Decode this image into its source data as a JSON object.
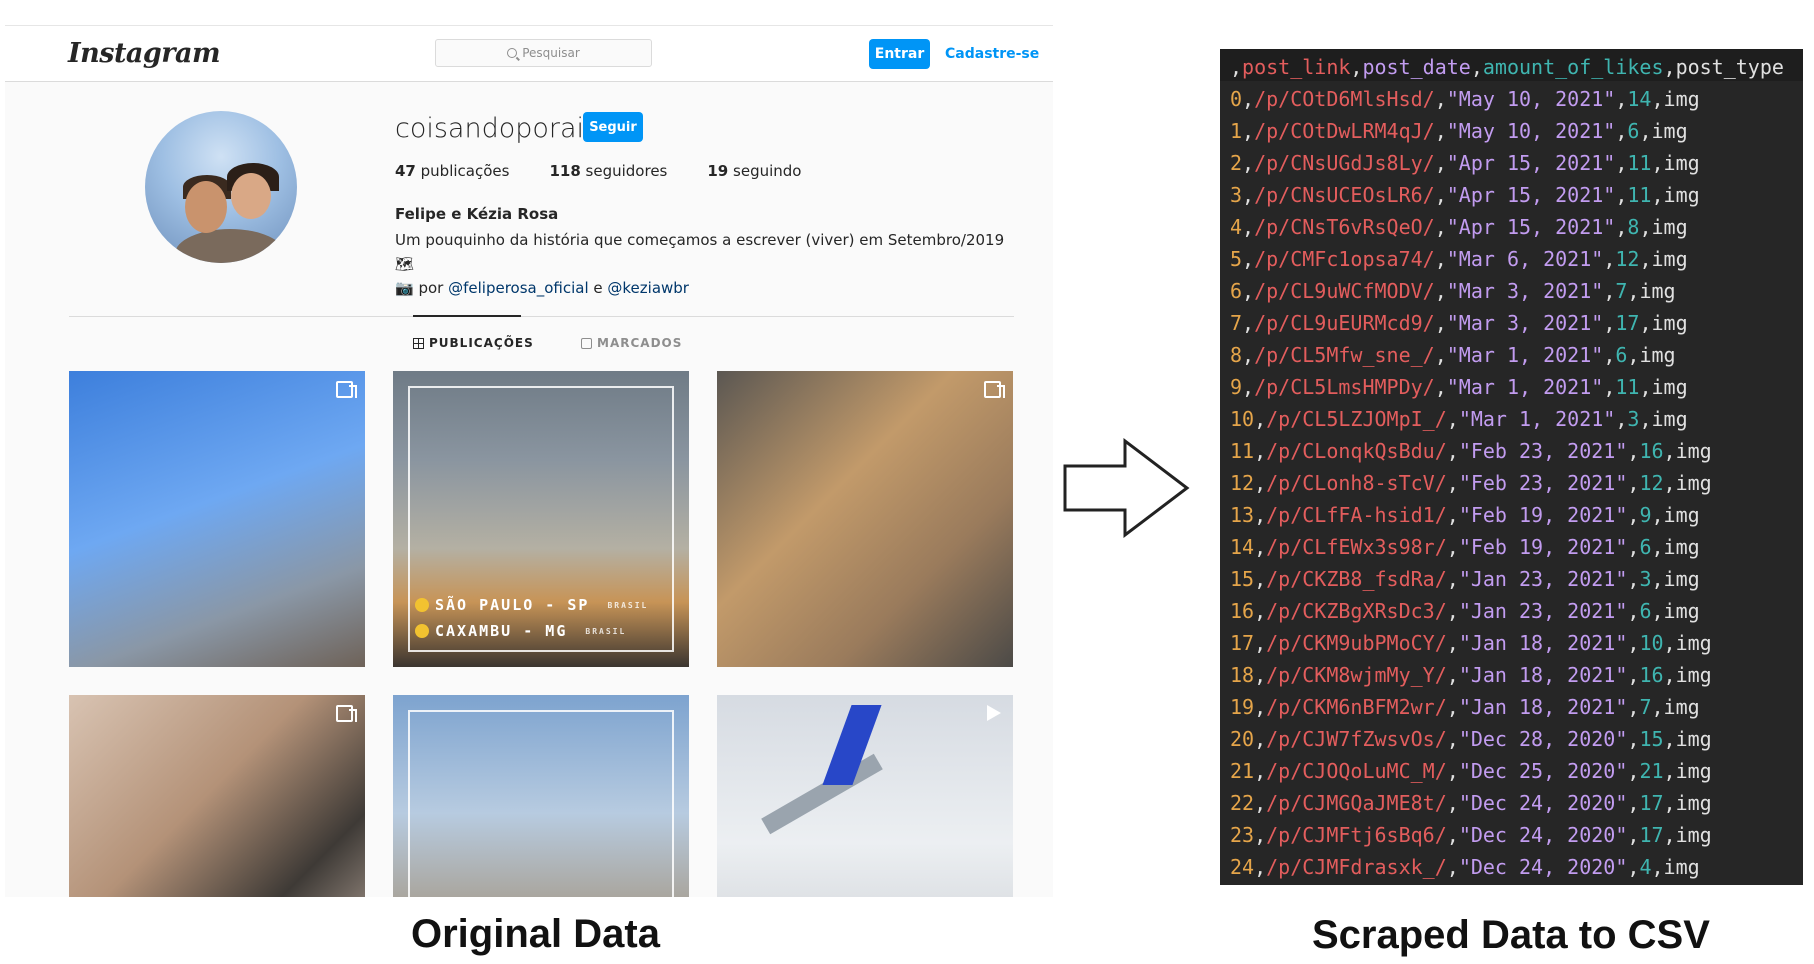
{
  "instagram": {
    "logo": "Instagram",
    "search_placeholder": "Pesquisar",
    "login_button": "Entrar",
    "signup_link": "Cadastre-se",
    "profile": {
      "username": "coisandoporai",
      "follow_button": "Seguir",
      "posts_count": "47",
      "posts_label": "publicações",
      "followers_count": "118",
      "followers_label": "seguidores",
      "following_count": "19",
      "following_label": "seguindo",
      "full_name": "Felipe e Kézia Rosa",
      "bio_line1": "Um pouquinho da história que começamos a escrever (viver) em Setembro/2019 🗺",
      "bio_line2_prefix": "📷 por",
      "bio_tag1": "@feliperosa_oficial",
      "bio_and": "e",
      "bio_tag2": "@keziawbr"
    },
    "tabs": [
      {
        "label": "PUBLICAÇÕES",
        "active": true
      },
      {
        "label": "MARCADOS",
        "active": false
      }
    ],
    "post2_overlay": {
      "line1": "SÃO PAULO - SP",
      "line1_small": "BRASIL",
      "line2": "CAXAMBU - MG",
      "line2_small": "BRASIL"
    }
  },
  "csv": {
    "header": {
      "c0": ",",
      "c1": "post_link",
      "c2": "post_date",
      "c3": "amount_of_likes",
      "c4": "post_type"
    },
    "rows": [
      {
        "idx": "0",
        "link": "/p/COtD6MlsHsd/",
        "date": "\"May 10, 2021\"",
        "likes": "14",
        "type": "img"
      },
      {
        "idx": "1",
        "link": "/p/COtDwLRM4qJ/",
        "date": "\"May 10, 2021\"",
        "likes": "6",
        "type": "img"
      },
      {
        "idx": "2",
        "link": "/p/CNsUGdJs8Ly/",
        "date": "\"Apr 15, 2021\"",
        "likes": "11",
        "type": "img"
      },
      {
        "idx": "3",
        "link": "/p/CNsUCEOsLR6/",
        "date": "\"Apr 15, 2021\"",
        "likes": "11",
        "type": "img"
      },
      {
        "idx": "4",
        "link": "/p/CNsT6vRsQeO/",
        "date": "\"Apr 15, 2021\"",
        "likes": "8",
        "type": "img"
      },
      {
        "idx": "5",
        "link": "/p/CMFc1opsa74/",
        "date": "\"Mar 6, 2021\"",
        "likes": "12",
        "type": "img"
      },
      {
        "idx": "6",
        "link": "/p/CL9uWCfMODV/",
        "date": "\"Mar 3, 2021\"",
        "likes": "7",
        "type": "img"
      },
      {
        "idx": "7",
        "link": "/p/CL9uEURMcd9/",
        "date": "\"Mar 3, 2021\"",
        "likes": "17",
        "type": "img"
      },
      {
        "idx": "8",
        "link": "/p/CL5Mfw_sne_/",
        "date": "\"Mar 1, 2021\"",
        "likes": "6",
        "type": "img"
      },
      {
        "idx": "9",
        "link": "/p/CL5LmsHMPDy/",
        "date": "\"Mar 1, 2021\"",
        "likes": "11",
        "type": "img"
      },
      {
        "idx": "10",
        "link": "/p/CL5LZJOMpI_/",
        "date": "\"Mar 1, 2021\"",
        "likes": "3",
        "type": "img"
      },
      {
        "idx": "11",
        "link": "/p/CLonqkQsBdu/",
        "date": "\"Feb 23, 2021\"",
        "likes": "16",
        "type": "img"
      },
      {
        "idx": "12",
        "link": "/p/CLonh8-sTcV/",
        "date": "\"Feb 23, 2021\"",
        "likes": "12",
        "type": "img"
      },
      {
        "idx": "13",
        "link": "/p/CLfFA-hsid1/",
        "date": "\"Feb 19, 2021\"",
        "likes": "9",
        "type": "img"
      },
      {
        "idx": "14",
        "link": "/p/CLfEWx3s98r/",
        "date": "\"Feb 19, 2021\"",
        "likes": "6",
        "type": "img"
      },
      {
        "idx": "15",
        "link": "/p/CKZB8_fsdRa/",
        "date": "\"Jan 23, 2021\"",
        "likes": "3",
        "type": "img"
      },
      {
        "idx": "16",
        "link": "/p/CKZBgXRsDc3/",
        "date": "\"Jan 23, 2021\"",
        "likes": "6",
        "type": "img"
      },
      {
        "idx": "17",
        "link": "/p/CKM9ubPMoCY/",
        "date": "\"Jan 18, 2021\"",
        "likes": "10",
        "type": "img"
      },
      {
        "idx": "18",
        "link": "/p/CKM8wjmMy_Y/",
        "date": "\"Jan 18, 2021\"",
        "likes": "16",
        "type": "img"
      },
      {
        "idx": "19",
        "link": "/p/CKM6nBFM2wr/",
        "date": "\"Jan 18, 2021\"",
        "likes": "7",
        "type": "img"
      },
      {
        "idx": "20",
        "link": "/p/CJW7fZwsvOs/",
        "date": "\"Dec 28, 2020\"",
        "likes": "15",
        "type": "img"
      },
      {
        "idx": "21",
        "link": "/p/CJOQoLuMC_M/",
        "date": "\"Dec 25, 2020\"",
        "likes": "21",
        "type": "img"
      },
      {
        "idx": "22",
        "link": "/p/CJMGQaJME8t/",
        "date": "\"Dec 24, 2020\"",
        "likes": "17",
        "type": "img"
      },
      {
        "idx": "23",
        "link": "/p/CJMFtj6sBq6/",
        "date": "\"Dec 24, 2020\"",
        "likes": "17",
        "type": "img"
      },
      {
        "idx": "24",
        "link": "/p/CJMFdrasxk_/",
        "date": "\"Dec 24, 2020\"",
        "likes": "4",
        "type": "img"
      }
    ]
  },
  "captions": {
    "left": "Original Data",
    "right": "Scraped Data to CSV"
  },
  "colors": {
    "ig_blue": "#0095f6",
    "csv_bg": "#262626",
    "csv_index": "#e5a54a",
    "csv_link": "#e35d5d",
    "csv_date": "#c29cf0",
    "csv_likes": "#3fb5b0"
  },
  "icons": {
    "search": "search-icon",
    "grid": "grid-icon",
    "tagged": "tagged-icon",
    "multi": "multiple-photos-icon",
    "video": "video-icon",
    "arrow": "right-arrow-icon"
  }
}
